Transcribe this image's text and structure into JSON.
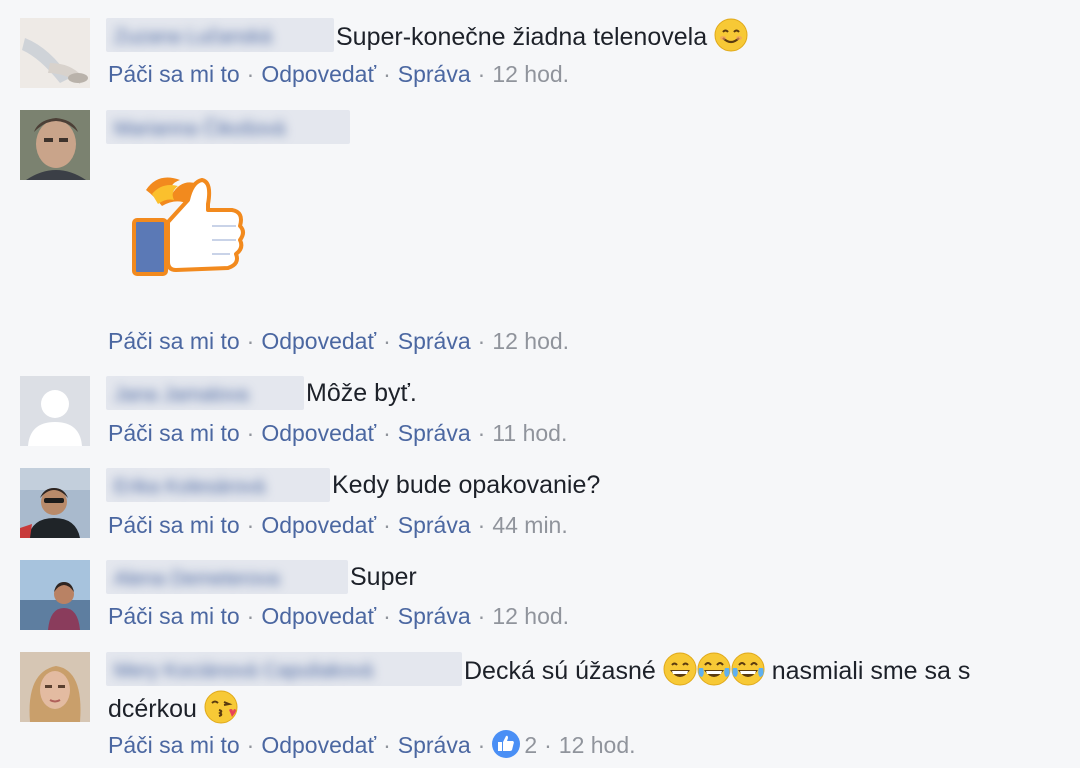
{
  "actions": {
    "like": "Páči sa mi to",
    "reply": "Odpovedať",
    "message": "Správa",
    "separator": "·"
  },
  "comments": [
    {
      "author": "Zuzana Lučanská",
      "text": "Super-konečne žiadna telenovela",
      "emoji_after": "smiling-face-icon",
      "time": "12 hod."
    },
    {
      "author": "Marianna Čikošová",
      "text": "",
      "sticker": "flaming-thumbs-up-sticker",
      "time": "12 hod."
    },
    {
      "author": "Jana Jamalova",
      "text": "Môže byť.",
      "time": "11 hod."
    },
    {
      "author": "Erika Kolesárová",
      "text": "Kedy bude opakovanie?",
      "time": "44 min."
    },
    {
      "author": "Alena Demeterova",
      "text": "Super",
      "time": "12 hod."
    },
    {
      "author": "Mery Kociánová Capuliaková",
      "text_part1": "Decká sú úžasné",
      "emoji_mid": [
        "grinning-face-icon",
        "tears-of-joy-icon",
        "tears-of-joy-icon"
      ],
      "text_part2": "nasmiali sme sa s",
      "text_line2": "dcérkou",
      "emoji_end": "kissing-face-icon",
      "likes": "2",
      "time": "12 hod."
    }
  ],
  "colors": {
    "link": "#4b67a1",
    "meta": "#90949c",
    "text": "#1d2129",
    "background": "#f6f7f9",
    "like_badge": "#4a8ff5"
  }
}
